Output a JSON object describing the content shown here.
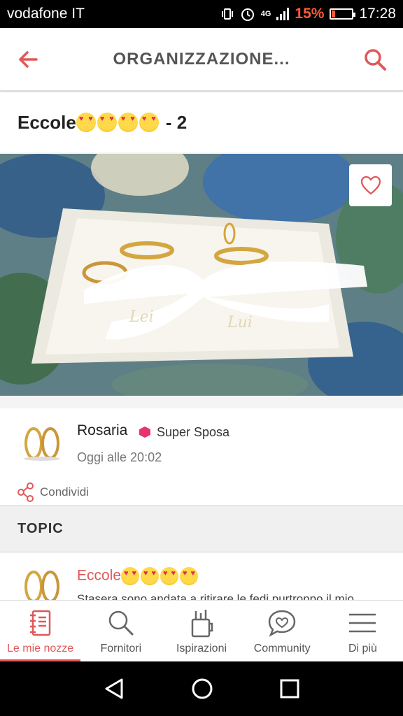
{
  "status_bar": {
    "carrier": "vodafone IT",
    "network": "4G",
    "battery": "15%",
    "battery_level": 0.15,
    "time": "17:28"
  },
  "header": {
    "title": "ORGANIZZAZIONE..."
  },
  "post": {
    "title": "Eccole",
    "title_suffix": "- 2",
    "emoji_count": 4
  },
  "author": {
    "name": "Rosaria",
    "badge": "Super Sposa",
    "time": "Oggi alle 20:02",
    "share_label": "Condividi"
  },
  "topic_section": {
    "heading": "TOPIC"
  },
  "topic": {
    "title": "Eccole",
    "snippet": "Stasera sono andata a ritirare le fedi purtroppo il mio"
  },
  "tabs": [
    {
      "label": "Le mie nozze",
      "icon": "notebook-icon",
      "active": true
    },
    {
      "label": "Fornitori",
      "icon": "search-icon",
      "active": false
    },
    {
      "label": "Ispirazioni",
      "icon": "cup-icon",
      "active": false
    },
    {
      "label": "Community",
      "icon": "chat-heart-icon",
      "active": false
    },
    {
      "label": "Di più",
      "icon": "menu-icon",
      "active": false
    }
  ],
  "colors": {
    "accent": "#e0585a",
    "badge": "#e8336d",
    "battery_low": "#ff5a36"
  }
}
